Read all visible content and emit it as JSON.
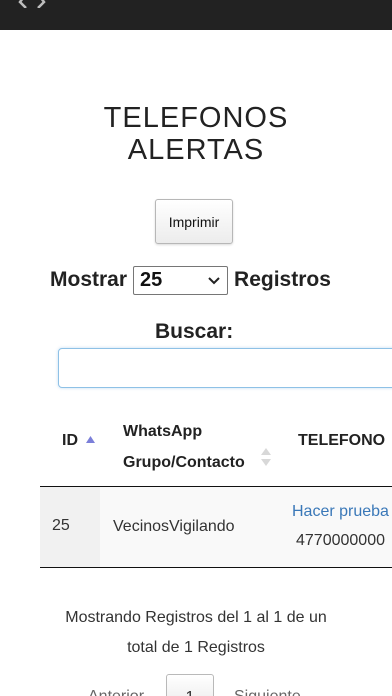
{
  "header": {
    "title_line1": "TELEFONOS",
    "title_line2": "ALERTAS"
  },
  "toolbar": {
    "print_label": "Imprimir"
  },
  "length_control": {
    "prefix": "Mostrar",
    "selected_value": "25",
    "suffix": "Registros"
  },
  "search": {
    "label": "Buscar:",
    "value": "",
    "placeholder": ""
  },
  "table": {
    "columns": [
      {
        "label": "ID",
        "sort": "ascending"
      },
      {
        "label_line1": "WhatsApp",
        "label_line2": "Grupo/Contacto",
        "sort": "none"
      },
      {
        "label": "TELEFONO"
      }
    ],
    "rows": [
      {
        "id": "25",
        "contact": "VecinosVigilando",
        "test_link": "Hacer prueba",
        "phone": "4770000000"
      }
    ]
  },
  "info": {
    "line1": "Mostrando Registros del 1 al 1 de un",
    "line2": "total de 1 Registros"
  },
  "pagination": {
    "prev_label": "Anterior",
    "current_page": "1",
    "next_label": "Siguiente"
  },
  "icons": {
    "back": "back-arrow-icon",
    "select_chevron": "chevron-down-icon",
    "sort_asc": "sort-ascending-icon",
    "sort_both": "sort-both-icon"
  },
  "colors": {
    "topbar": "#222222",
    "link": "#3a78b8",
    "sort_active": "#7b7fd9",
    "sort_inactive": "#d8d8d8"
  }
}
